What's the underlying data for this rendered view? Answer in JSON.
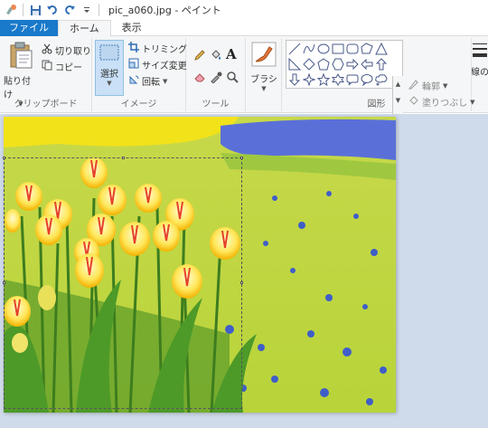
{
  "window": {
    "title": "pic_a060.jpg - ペイント"
  },
  "qat": {
    "icons": [
      "paint-app-icon",
      "save-icon",
      "undo-icon",
      "redo-icon",
      "customize-qat-icon"
    ]
  },
  "tabs": [
    {
      "label": "ファイル"
    },
    {
      "label": "ホーム"
    },
    {
      "label": "表示"
    }
  ],
  "ribbon": {
    "clipboard": {
      "paste": "貼り付け",
      "cut": "切り取り",
      "copy": "コピー",
      "group": "クリップボード"
    },
    "image": {
      "select": "選択",
      "crop": "トリミング",
      "resize": "サイズ変更",
      "rotate": "回転",
      "group": "イメージ"
    },
    "tools": {
      "group": "ツール"
    },
    "brush": {
      "label": "ブラシ"
    },
    "shapes": {
      "outline": "輪郭",
      "fill": "塗りつぶし",
      "group": "図形"
    },
    "size": {
      "label": "線の"
    }
  },
  "colors": {
    "file_tab": "#1979ca",
    "ribbon_bg": "#f5f6f7",
    "canvas_bg": "#cfdaea",
    "select_highlight": "#c9e0f7"
  }
}
